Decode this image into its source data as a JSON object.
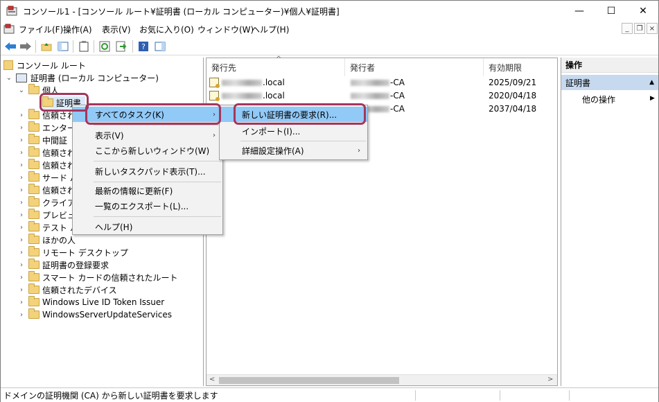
{
  "window": {
    "title": "コンソール1 - [コンソール ルート¥証明書 (ローカル コンピューター)¥個人¥証明書]",
    "minimize": "—",
    "maximize": "☐",
    "close": "✕",
    "mdi_min": "_",
    "mdi_restore": "❐",
    "mdi_close": "×"
  },
  "menubar": {
    "items": [
      "ファイル(F)",
      "操作(A)",
      "表示(V)",
      "お気に入り(O)",
      "ウィンドウ(W)",
      "ヘルプ(H)"
    ]
  },
  "toolbar": {
    "back": "←",
    "forward": "→",
    "up": "📁",
    "show_hide": "▦",
    "properties": "📋",
    "refresh": "⟳",
    "export": "⇥",
    "help": "?",
    "action_pane": "▤"
  },
  "tree": {
    "root": "コンソール ルート",
    "certs": "証明書 (ローカル コンピューター)",
    "personal": "個人",
    "personal_certs": "証明書",
    "partial_items": [
      "信頼され",
      "エンター",
      "中間証",
      "信頼され",
      "信頼され",
      "サード パ",
      "信頼され",
      "クライア",
      "プレビュー",
      "テスト ル"
    ],
    "items": [
      "ほかの人",
      "リモート デスクトップ",
      "証明書の登録要求",
      "スマート カードの信頼されたルート",
      "信頼されたデバイス",
      "Windows Live ID Token Issuer",
      "WindowsServerUpdateServices"
    ]
  },
  "list": {
    "columns": [
      "発行先",
      "発行者",
      "有効期限"
    ],
    "rows": [
      {
        "issued_to": ".local",
        "issuer": "-CA",
        "expires": "2025/09/21"
      },
      {
        "issued_to": ".local",
        "issuer": "-CA",
        "expires": "2020/04/18"
      },
      {
        "issued_to": "",
        "issuer": "-CA",
        "expires": "2037/04/18"
      }
    ]
  },
  "actions": {
    "header": "操作",
    "section": "証明書",
    "section_arrow": "▲",
    "other": "他の操作",
    "other_arrow": "▶"
  },
  "context_menu": {
    "items": [
      "すべてのタスク(K)",
      "表示(V)",
      "ここから新しいウィンドウ(W)",
      "新しいタスクパッド表示(T)...",
      "最新の情報に更新(F)",
      "一覧のエクスポート(L)...",
      "ヘルプ(H)"
    ],
    "arrow": "›"
  },
  "submenu": {
    "items": [
      "新しい証明書の要求(R)...",
      "インポート(I)...",
      "詳細設定操作(A)"
    ],
    "arrow": "›"
  },
  "scroll": {
    "left": "<",
    "right": ">"
  },
  "status": {
    "text": "ドメインの証明機関 (CA) から新しい証明書を要求します"
  },
  "colors": {
    "highlight": "#91c9f7",
    "callout": "#a3365c",
    "action_section": "#c6d9ef"
  }
}
